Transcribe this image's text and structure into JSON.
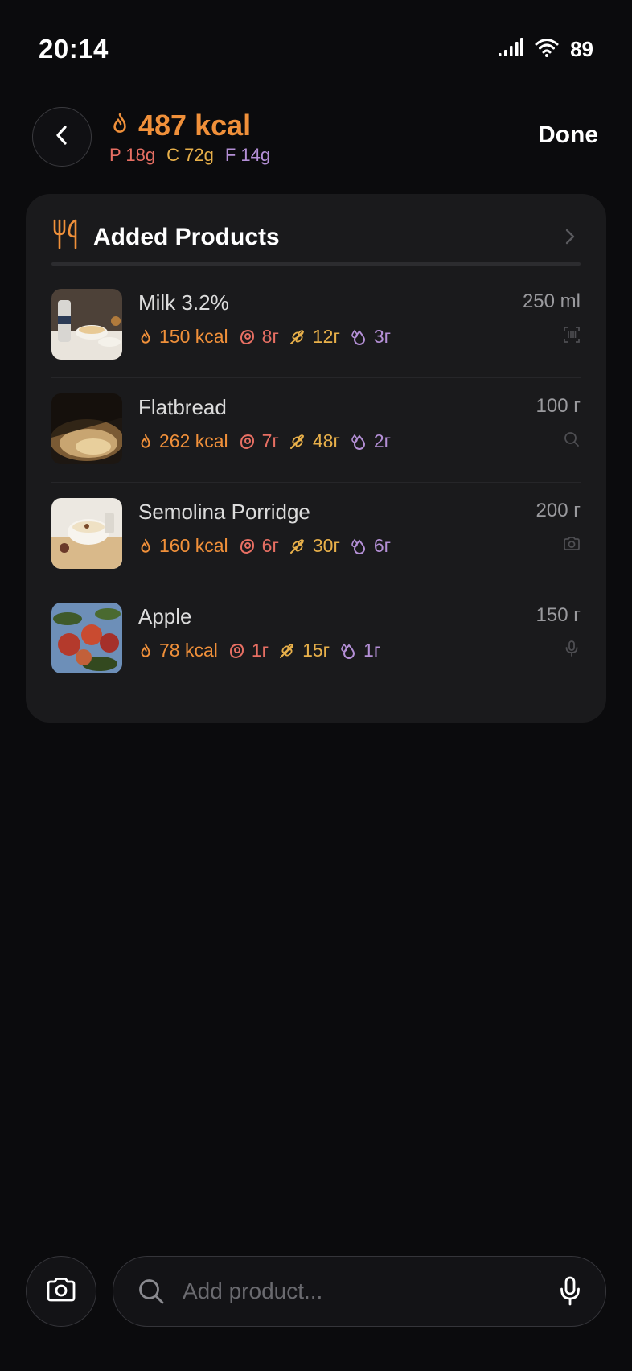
{
  "status": {
    "time": "20:14",
    "battery": "89"
  },
  "header": {
    "total_kcal": "487 kcal",
    "macros": {
      "protein": "P 18g",
      "carbs": "C 72g",
      "fat": "F 14g"
    },
    "done_label": "Done"
  },
  "card": {
    "title": "Added Products",
    "items": [
      {
        "name": "Milk 3.2%",
        "qty": "250 ml",
        "kcal": "150 kcal",
        "protein": "8г",
        "carbs": "12г",
        "fat": "3г",
        "source_icon": "barcode-scan-icon"
      },
      {
        "name": "Flatbread",
        "qty": "100 г",
        "kcal": "262 kcal",
        "protein": "7г",
        "carbs": "48г",
        "fat": "2г",
        "source_icon": "search-icon"
      },
      {
        "name": "Semolina Porridge",
        "qty": "200 г",
        "kcal": "160 kcal",
        "protein": "6г",
        "carbs": "30г",
        "fat": "6г",
        "source_icon": "camera-icon"
      },
      {
        "name": "Apple",
        "qty": "150 г",
        "kcal": "78 kcal",
        "protein": "1г",
        "carbs": "15г",
        "fat": "1г",
        "source_icon": "microphone-icon"
      }
    ]
  },
  "search": {
    "placeholder": "Add product..."
  },
  "colors": {
    "kcal": "#f0903a",
    "protein": "#e76f63",
    "carbs": "#e8b04a",
    "fat": "#b48fd6",
    "background": "#0b0b0d",
    "card": "#1a1a1c"
  }
}
